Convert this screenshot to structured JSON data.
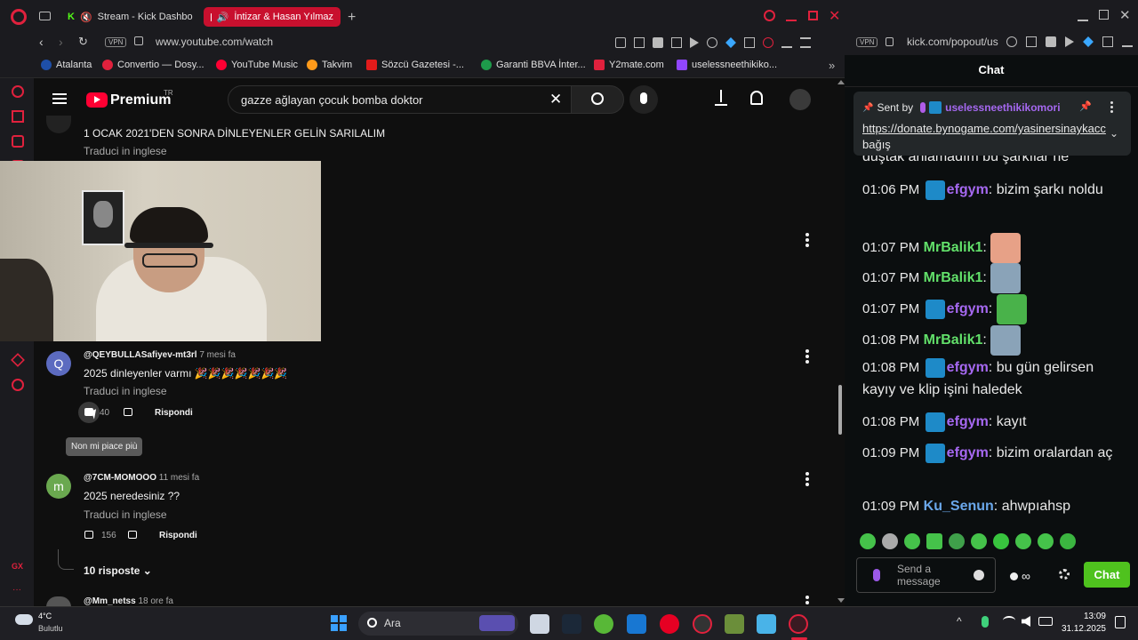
{
  "opera": {
    "tabs": [
      {
        "label": "Stream - Kick Dashbo"
      },
      {
        "label": "İntizar & Hasan Yılmaz"
      }
    ],
    "address": "www.youtube.com/watch",
    "vpn": "VPN",
    "bookmarks": [
      {
        "label": "Atalanta"
      },
      {
        "label": "Convertio — Dosy..."
      },
      {
        "label": "YouTube Music"
      },
      {
        "label": "Takvim"
      },
      {
        "label": "Sözcü Gazetesi -..."
      },
      {
        "label": "Garanti BBVA İnter..."
      },
      {
        "label": "Y2mate.com"
      },
      {
        "label": "uselessneethikiko..."
      }
    ],
    "sidebar_gx": "GX",
    "sidebar_more": "···"
  },
  "youtube": {
    "logo_text": "Premium",
    "logo_sup": "TR",
    "search_value": "gazze ağlayan çocuk bomba doktor",
    "comments": [
      {
        "text": "1 OCAK 2021'DEN SONRA DİNLEYENLER GELİN SARILALIM",
        "translate": "Traduci in inglese"
      },
      {
        "author": "@QEYBULLASafiyev-mt3rl",
        "age": "7 mesi fa",
        "avatar": "Q",
        "text": "2025 dinleyenler varmı 🎉🎉🎉🎉🎉🎉🎉",
        "translate": "Traduci in inglese",
        "likes": "40",
        "reply": "Rispondi",
        "tooltip": "Non mi piace più"
      },
      {
        "author": "@7CM-MOMOOO",
        "age": "11 mesi fa",
        "avatar": "m",
        "text": "2025 neredesiniz ??",
        "translate": "Traduci in inglese",
        "likes": "156",
        "reply": "Rispondi"
      },
      {
        "author": "@Mm_netss",
        "age": "18 ore fa"
      }
    ],
    "replies_toggle": "10 risposte"
  },
  "kick": {
    "address": "kick.com/popout/us",
    "vpn": "VPN",
    "chat_title": "Chat",
    "pinned": {
      "sent_by": "Sent by",
      "user": "uselessneethikikomori",
      "link": "https://donate.bynogame.com/yasinersinaykacc",
      "suffix": "bağış",
      "behind": "duştak anlamadım bu şarkılar ne"
    },
    "messages": [
      {
        "time": "01:06 PM",
        "user": "efgym",
        "color": "purple",
        "text": "bizim şarkı noldu"
      },
      {
        "time": "01:07 PM",
        "user": "MrBalik1",
        "color": "green",
        "text": ""
      },
      {
        "time": "01:07 PM",
        "user": "MrBalik1",
        "color": "green",
        "text": ""
      },
      {
        "time": "01:07 PM",
        "user": "efgym",
        "color": "purple",
        "text": ""
      },
      {
        "time": "01:08 PM",
        "user": "MrBalik1",
        "color": "green",
        "text": ""
      },
      {
        "time": "01:08 PM",
        "user": "efgym",
        "color": "purple",
        "text": "bu gün gelirsen kayıy ve klip işini haledek"
      },
      {
        "time": "01:08 PM",
        "user": "efgym",
        "color": "purple",
        "text": "kayıt"
      },
      {
        "time": "01:09 PM",
        "user": "efgym",
        "color": "purple",
        "text": "bizim oralardan aç"
      },
      {
        "time": "01:09 PM",
        "user": "Ku_Senun",
        "color": "blue",
        "text": "ahwpıahsp"
      }
    ],
    "send_placeholder": "Send a message",
    "chat_button": "Chat"
  },
  "taskbar": {
    "weather_temp": "4°C",
    "weather_desc": "Bulutlu",
    "search": "Ara",
    "time": "13:09",
    "date": "31.12.2025"
  }
}
